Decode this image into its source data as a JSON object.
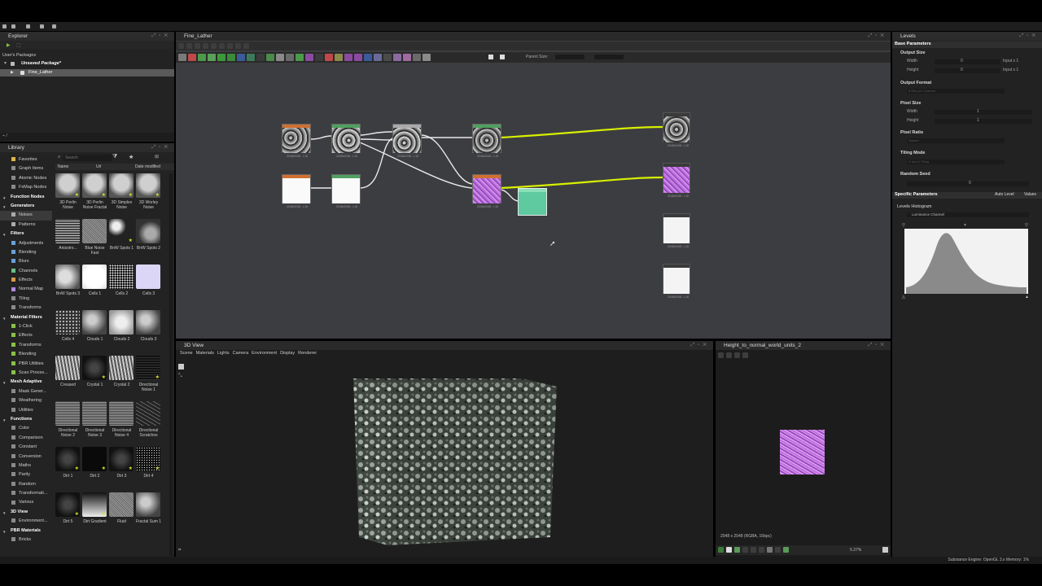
{
  "explorer": {
    "title": "Explorer",
    "section": "User's Packages",
    "package": "Unsaved Package*",
    "graph": "Fine_Lather"
  },
  "library": {
    "title": "Library",
    "search_placeholder": "Search",
    "col_name": "Name",
    "col_url": "Url",
    "col_date": "Date modified",
    "tree": [
      {
        "label": "Favorites",
        "cat": false,
        "sel": false,
        "color": "#e0b64a"
      },
      {
        "label": "Graph Items",
        "cat": false,
        "sel": false,
        "color": "#8a8a8a"
      },
      {
        "label": "Atomic Nodes",
        "cat": false,
        "sel": false,
        "color": "#8a8a8a"
      },
      {
        "label": "FxMap Nodes",
        "cat": false,
        "sel": false,
        "color": "#8a8a8a"
      },
      {
        "label": "Function Nodes",
        "cat": true,
        "sel": false,
        "color": "#8a8a8a"
      },
      {
        "label": "Generators",
        "cat": true,
        "sel": false,
        "color": "#8a8a8a"
      },
      {
        "label": "Noises",
        "cat": false,
        "sel": true,
        "color": "#aaaaaa"
      },
      {
        "label": "Patterns",
        "cat": false,
        "sel": false,
        "color": "#aaaaaa"
      },
      {
        "label": "Filters",
        "cat": true,
        "sel": false,
        "color": "#8a8a8a"
      },
      {
        "label": "Adjustments",
        "cat": false,
        "sel": false,
        "color": "#6aa0d8"
      },
      {
        "label": "Blending",
        "cat": false,
        "sel": false,
        "color": "#6aa0d8"
      },
      {
        "label": "Blurs",
        "cat": false,
        "sel": false,
        "color": "#6aa0d8"
      },
      {
        "label": "Channels",
        "cat": false,
        "sel": false,
        "color": "#6ac08a"
      },
      {
        "label": "Effects",
        "cat": false,
        "sel": false,
        "color": "#d89a4a"
      },
      {
        "label": "Normal Map",
        "cat": false,
        "sel": false,
        "color": "#b08ae0"
      },
      {
        "label": "Tiling",
        "cat": false,
        "sel": false,
        "color": "#8a8a8a"
      },
      {
        "label": "Transforms",
        "cat": false,
        "sel": false,
        "color": "#8a8a8a"
      },
      {
        "label": "Material Filters",
        "cat": true,
        "sel": false,
        "color": "#8a8a8a"
      },
      {
        "label": "1-Click",
        "cat": false,
        "sel": false,
        "color": "#8ac04a"
      },
      {
        "label": "Effects",
        "cat": false,
        "sel": false,
        "color": "#8ac04a"
      },
      {
        "label": "Transforms",
        "cat": false,
        "sel": false,
        "color": "#8ac04a"
      },
      {
        "label": "Blending",
        "cat": false,
        "sel": false,
        "color": "#8ac04a"
      },
      {
        "label": "PBR Utilities",
        "cat": false,
        "sel": false,
        "color": "#8ac04a"
      },
      {
        "label": "Scan Proces...",
        "cat": false,
        "sel": false,
        "color": "#8ac04a"
      },
      {
        "label": "Mesh Adaptive",
        "cat": true,
        "sel": false,
        "color": "#8a8a8a"
      },
      {
        "label": "Mask Gener...",
        "cat": false,
        "sel": false,
        "color": "#8a8a8a"
      },
      {
        "label": "Weathering",
        "cat": false,
        "sel": false,
        "color": "#8a8a8a"
      },
      {
        "label": "Utilities",
        "cat": false,
        "sel": false,
        "color": "#8a8a8a"
      },
      {
        "label": "Functions",
        "cat": true,
        "sel": false,
        "color": "#8a8a8a"
      },
      {
        "label": "Color",
        "cat": false,
        "sel": false,
        "color": "#8a8a8a"
      },
      {
        "label": "Comparison",
        "cat": false,
        "sel": false,
        "color": "#8a8a8a"
      },
      {
        "label": "Constant",
        "cat": false,
        "sel": false,
        "color": "#8a8a8a"
      },
      {
        "label": "Conversion",
        "cat": false,
        "sel": false,
        "color": "#8a8a8a"
      },
      {
        "label": "Maths",
        "cat": false,
        "sel": false,
        "color": "#8a8a8a"
      },
      {
        "label": "Parity",
        "cat": false,
        "sel": false,
        "color": "#8a8a8a"
      },
      {
        "label": "Random",
        "cat": false,
        "sel": false,
        "color": "#8a8a8a"
      },
      {
        "label": "Transformati...",
        "cat": false,
        "sel": false,
        "color": "#8a8a8a"
      },
      {
        "label": "Various",
        "cat": false,
        "sel": false,
        "color": "#8a8a8a"
      },
      {
        "label": "3D View",
        "cat": true,
        "sel": false,
        "color": "#8a8a8a"
      },
      {
        "label": "Environment...",
        "cat": false,
        "sel": false,
        "color": "#8a8a8a"
      },
      {
        "label": "PBR Materials",
        "cat": true,
        "sel": false,
        "color": "#8a8a8a"
      },
      {
        "label": "Bricks",
        "cat": false,
        "sel": false,
        "color": "#8a8a8a"
      }
    ],
    "thumbs": [
      {
        "label": "3D Perlin Noise",
        "kind": "cube",
        "star": true
      },
      {
        "label": "3D Perlin Noise Fractal",
        "kind": "cube",
        "star": true
      },
      {
        "label": "3D Simplex Noise",
        "kind": "cube",
        "star": true
      },
      {
        "label": "3D Worley Noise",
        "kind": "cube",
        "star": true
      },
      {
        "label": "Anisotro...",
        "kind": "aniso",
        "star": false
      },
      {
        "label": "Blue Noise Fast",
        "kind": "fine",
        "star": false
      },
      {
        "label": "BnW Spots 1",
        "kind": "spots",
        "star": true
      },
      {
        "label": "BnW Spots 2",
        "kind": "spots2",
        "star": false
      },
      {
        "label": "BnW Spots 3",
        "kind": "soft",
        "star": false
      },
      {
        "label": "Cells 1",
        "kind": "white",
        "star": false
      },
      {
        "label": "Cells 2",
        "kind": "dots",
        "star": false
      },
      {
        "label": "Cells 3",
        "kind": "lavender",
        "star": false
      },
      {
        "label": "Cells 4",
        "kind": "dots2",
        "star": false
      },
      {
        "label": "Clouds 1",
        "kind": "cloud",
        "star": false
      },
      {
        "label": "Clouds 2",
        "kind": "cloudL",
        "star": false
      },
      {
        "label": "Clouds 3",
        "kind": "cloud",
        "star": false
      },
      {
        "label": "Creased",
        "kind": "crease",
        "star": false
      },
      {
        "label": "Crystal 1",
        "kind": "dark",
        "star": true
      },
      {
        "label": "Crystal 2",
        "kind": "crease",
        "star": false
      },
      {
        "label": "Directional Noise 1",
        "kind": "dirdark",
        "star": true
      },
      {
        "label": "Directional Noise 2",
        "kind": "dir",
        "star": false
      },
      {
        "label": "Directional Noise 3",
        "kind": "dir",
        "star": false
      },
      {
        "label": "Directional Noise 4",
        "kind": "dir",
        "star": false
      },
      {
        "label": "Directional Scratches",
        "kind": "scratch",
        "star": false
      },
      {
        "label": "Dirt 1",
        "kind": "dark",
        "star": true
      },
      {
        "label": "Dirt 2",
        "kind": "black",
        "star": true
      },
      {
        "label": "Dirt 3",
        "kind": "dark",
        "star": true
      },
      {
        "label": "Dirt 4",
        "kind": "specks",
        "star": true
      },
      {
        "label": "Dirt 5",
        "kind": "dark",
        "star": true
      },
      {
        "label": "Dirt Gradient",
        "kind": "grad",
        "star": true
      },
      {
        "label": "Fluid",
        "kind": "fine",
        "star": false
      },
      {
        "label": "Fractal Sum 1",
        "kind": "cloud",
        "star": false
      }
    ]
  },
  "graph": {
    "title": "Fine_Lather",
    "parent_size_label": "Parent Size:",
    "node_caption": "2048x2048 - L16"
  },
  "view3d": {
    "title": "3D View",
    "menu": [
      "Scene",
      "Materials",
      "Lights",
      "Camera",
      "Environment",
      "Display",
      "Renderer"
    ]
  },
  "view2d": {
    "title": "Height_to_normal_world_units_2",
    "info": "2048 x 2048 (RGBA, 16bpc)",
    "zoom": "5.37%"
  },
  "levels": {
    "title": "Levels",
    "base_params": "Base Parameters",
    "output_size": "Output Size",
    "width": "Width",
    "height": "Height",
    "input_x1": "Input x 1",
    "zero": "0",
    "output_format": "Output Format",
    "output_format_value": "8 Bits per Channel",
    "pixel_size": "Pixel Size",
    "one": "1",
    "pixel_ratio": "Pixel Ratio",
    "pixel_ratio_value": "Square",
    "tiling_mode": "Tiling Mode",
    "tiling_mode_value": "H and V Tiling",
    "random_seed": "Random Seed",
    "specific_params": "Specific Parameters",
    "auto_level": "Auto Level",
    "values": "Values",
    "histogram": "Levels Histogram",
    "channel": "Luminance Channel"
  },
  "status": {
    "engine": "Substance Engine: OpenGL 3.x  Memory: 1%"
  },
  "colors": {
    "accent_yellow": "#d8f000",
    "node_purple": "#c070e0",
    "node_teal": "#5fc9a0"
  }
}
